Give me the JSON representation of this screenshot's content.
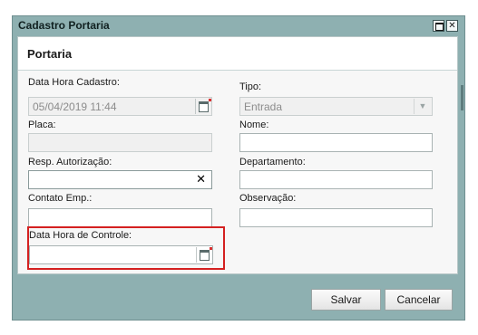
{
  "window": {
    "title": "Cadastro Portaria",
    "maximize_icon": "maximize-icon",
    "close_icon": "close-icon",
    "close_glyph": "✕"
  },
  "panel": {
    "title": "Portaria"
  },
  "form": {
    "data_hora_cadastro": {
      "label": "Data Hora Cadastro:",
      "value": "05/04/2019 11:44"
    },
    "tipo": {
      "label": "Tipo:",
      "value": "Entrada"
    },
    "placa": {
      "label": "Placa:",
      "value": ""
    },
    "nome": {
      "label": "Nome:",
      "value": ""
    },
    "resp_autorizacao": {
      "label": "Resp. Autorização:",
      "value": "",
      "clear_glyph": "✕"
    },
    "departamento": {
      "label": "Departamento:",
      "value": ""
    },
    "contato_emp": {
      "label": "Contato Emp.:",
      "value": ""
    },
    "observacao": {
      "label": "Observação:",
      "value": ""
    },
    "data_hora_controle": {
      "label": "Data Hora de Controle:",
      "value": ""
    }
  },
  "buttons": {
    "salvar": "Salvar",
    "cancelar": "Cancelar"
  },
  "colors": {
    "window_bg": "#8eb0b1",
    "highlight": "#d42020"
  }
}
